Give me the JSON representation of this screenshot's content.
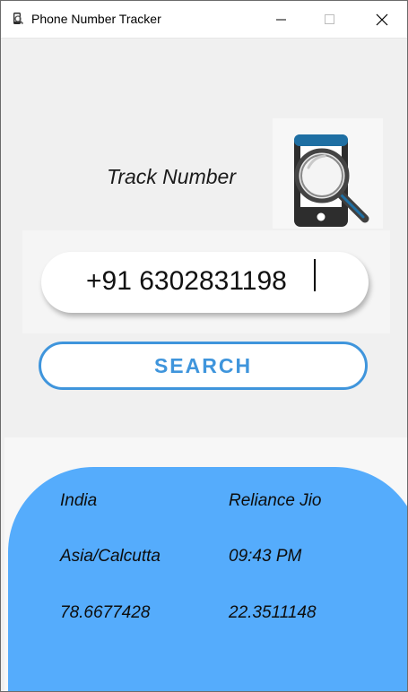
{
  "window": {
    "title": "Phone Number Tracker"
  },
  "header": {
    "track_label": "Track Number"
  },
  "search": {
    "phone_value": "+91 6302831198",
    "button_label": "SEARCH"
  },
  "results": {
    "country": "India",
    "carrier": "Reliance Jio",
    "timezone": "Asia/Calcutta",
    "local_time": "09:43 PM",
    "longitude": "78.6677428",
    "latitude": "22.3511148"
  },
  "colors": {
    "accent": "#3f95dc",
    "result_card": "#55acfc",
    "background": "#f0f0f0"
  },
  "icons": {
    "app": "phone-search-icon",
    "logo": "phone-magnifier-icon"
  }
}
